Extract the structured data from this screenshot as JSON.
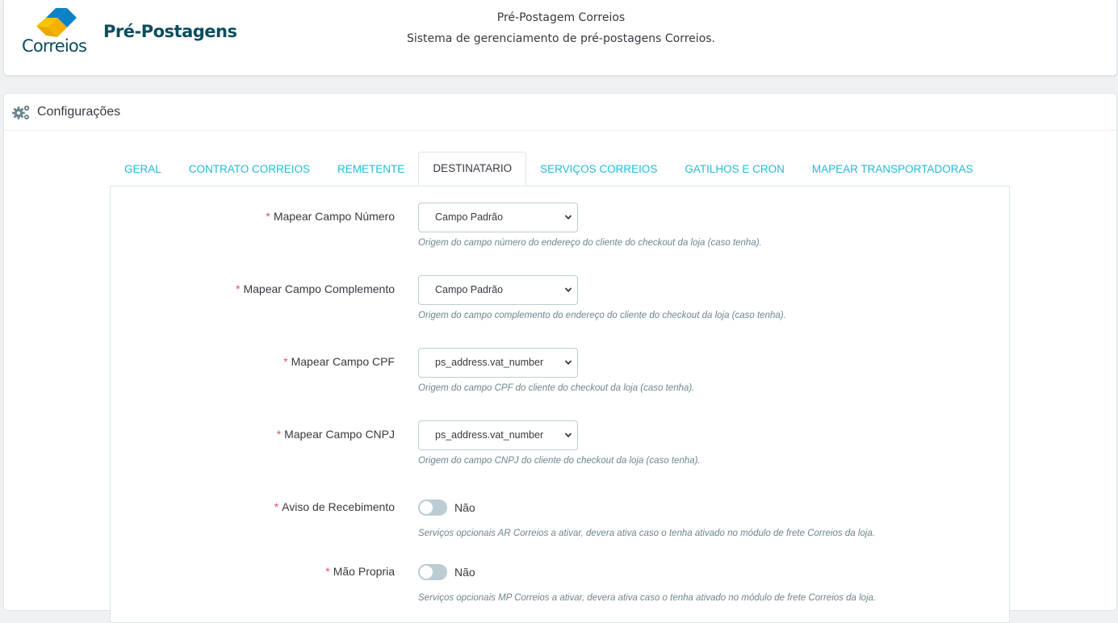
{
  "header": {
    "logo_title": "Pré-Postagens",
    "logo_brand": "Correios",
    "title": "Pré-Postagem Correios",
    "subtitle": "Sistema de gerenciamento de pré-postagens Correios."
  },
  "panel": {
    "icon": "cogs-icon",
    "title": "Configurações"
  },
  "tabs": [
    {
      "label": "GERAL",
      "active": false
    },
    {
      "label": "CONTRATO CORREIOS",
      "active": false
    },
    {
      "label": "REMETENTE",
      "active": false
    },
    {
      "label": "DESTINATARIO",
      "active": true
    },
    {
      "label": "SERVIÇOS CORREIOS",
      "active": false
    },
    {
      "label": "GATILHOS E CRON",
      "active": false
    },
    {
      "label": "MAPEAR TRANSPORTADORAS",
      "active": false
    }
  ],
  "fields": [
    {
      "label": "Mapear Campo Número",
      "required": "*",
      "type": "select",
      "value": "Campo Padrão",
      "help": "Origem do campo número do endereço do cliente do checkout da loja (caso tenha)."
    },
    {
      "label": "Mapear Campo Complemento",
      "required": "*",
      "type": "select",
      "value": "Campo Padrão",
      "help": "Origem do campo complemento do endereço do cliente do checkout da loja (caso tenha)."
    },
    {
      "label": "Mapear Campo CPF",
      "required": "*",
      "type": "select",
      "value": "ps_address.vat_number",
      "help": "Origem do campo CPF do cliente do checkout da loja (caso tenha)."
    },
    {
      "label": "Mapear Campo CNPJ",
      "required": "*",
      "type": "select",
      "value": "ps_address.vat_number",
      "help": "Origem do campo CNPJ do cliente do checkout da loja (caso tenha)."
    },
    {
      "label": "Aviso de Recebimento",
      "required": "*",
      "type": "toggle",
      "value": "Não",
      "help": "Serviços opcionais AR Correios a ativar, devera ativa caso o tenha ativado no módulo de frete Correios da loja."
    },
    {
      "label": "Mão Propria",
      "required": "*",
      "type": "toggle",
      "value": "Não",
      "help": "Serviços opcionais MP Correios a ativar, devera ativa caso o tenha ativado no módulo de frete Correios da loja."
    }
  ],
  "colors": {
    "accent": "#25b9d7",
    "required": "#e84e6a",
    "logo_teal": "#0b4d5e",
    "logo_yellow": "#f5c400",
    "logo_blue": "#0b82c6"
  }
}
